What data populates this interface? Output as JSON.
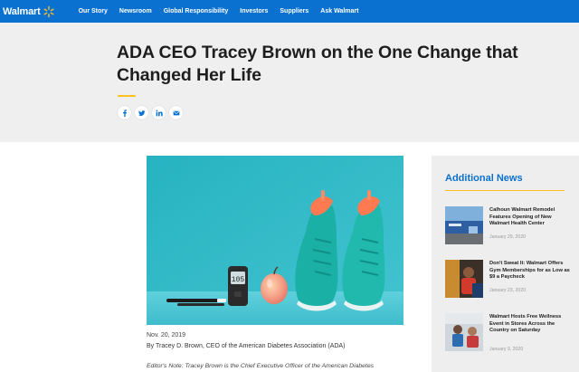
{
  "nav": {
    "brand": "Walmart",
    "items": [
      "Our Story",
      "Newsroom",
      "Global Responsibility",
      "Investors",
      "Suppliers",
      "Ask Walmart"
    ]
  },
  "article": {
    "title": "ADA CEO Tracey Brown on the One Change that Changed Her Life",
    "date": "Nov. 20, 2019",
    "byline": "By Tracey D. Brown, CEO of the American Diabetes Association (ADA)",
    "editor_note": "Editor's Note: Tracey Brown is the Chief Executive Officer of the American Diabetes"
  },
  "share": [
    "facebook-icon",
    "twitter-icon",
    "linkedin-icon",
    "email-icon"
  ],
  "image": {
    "glucose_reading": "105"
  },
  "sidebar": {
    "title": "Additional News",
    "items": [
      {
        "headline": "Calhoun Walmart Remodel Features Opening of New Walmart Health Center",
        "date": "January 29, 2020"
      },
      {
        "headline": "Don't Sweat It: Walmart Offers Gym Memberships for as Low as $9 a Paycheck",
        "date": "January 23, 2020"
      },
      {
        "headline": "Walmart Hosts Free Wellness Event in Stores Across the Country on Saturday",
        "date": "January 9, 2020"
      }
    ]
  },
  "colors": {
    "nav_blue": "#0a71d0",
    "accent_yellow": "#ffc220",
    "hero_gray": "#efefef"
  }
}
